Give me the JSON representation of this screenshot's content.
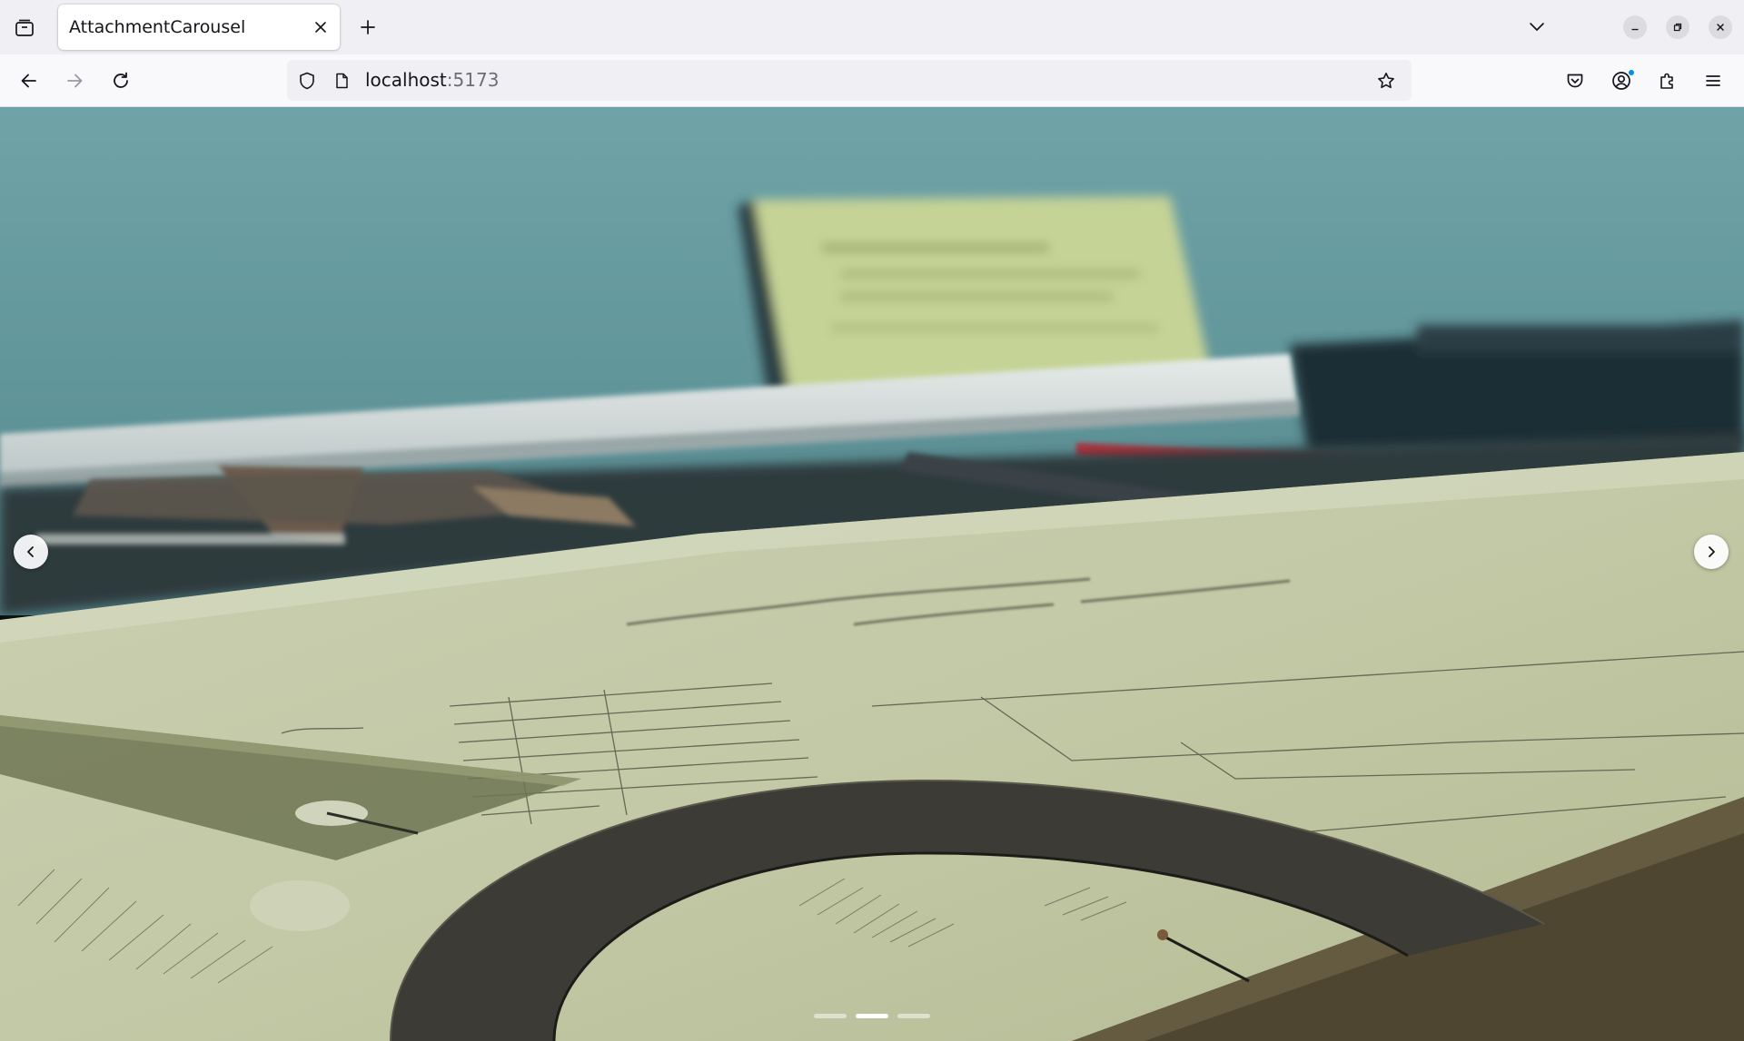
{
  "browser": {
    "tab": {
      "title": "AttachmentCarousel",
      "close_icon": "close-icon"
    },
    "toolbar_icons": {
      "tab_list": "tab-list-icon",
      "new_tab": "plus-icon",
      "list_all_tabs": "chevron-down-icon",
      "minimize": "minimize-icon",
      "restore": "restore-icon",
      "close_window": "close-icon"
    },
    "nav": {
      "back": "arrow-left-icon",
      "forward": "arrow-right-icon",
      "reload": "reload-icon"
    },
    "url": {
      "host": "localhost",
      "port": ":5173",
      "shield_icon": "shield-icon",
      "page_icon": "page-icon",
      "bookmark_icon": "star-icon"
    },
    "right_icons": {
      "pocket": "pocket-icon",
      "account": "account-icon",
      "extensions": "puzzle-icon",
      "menu": "hamburger-menu-icon"
    }
  },
  "carousel": {
    "prev_icon": "chevron-left-icon",
    "next_icon": "chevron-right-icon",
    "slide_count": 3,
    "active_index": 1,
    "image_subject": "drafting tools on architectural drawings"
  },
  "colors": {
    "tab_strip": "#f0f0f4",
    "nav_bar": "#f9f9fb",
    "indicator_active": "#ffffff",
    "indicator_inactive": "#ffffff80",
    "account_badge": "#0090ed"
  }
}
